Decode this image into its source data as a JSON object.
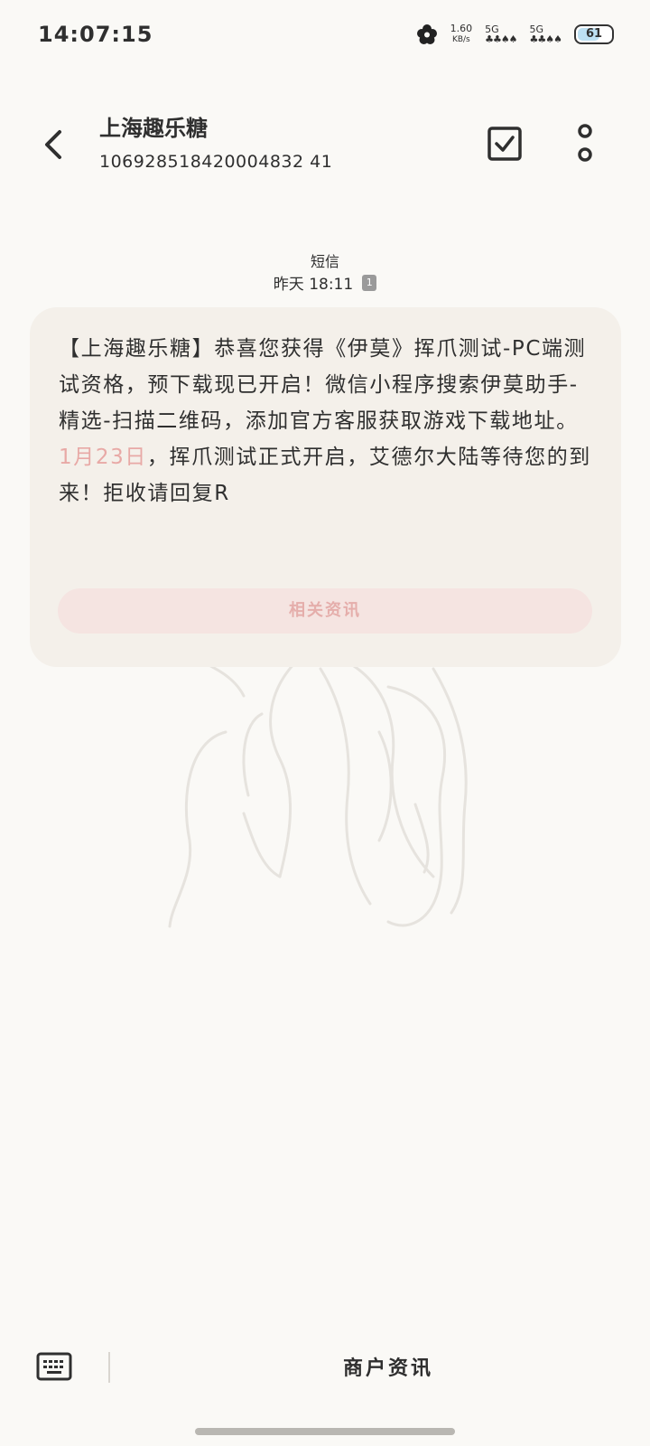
{
  "status_bar": {
    "time": "14:07:15",
    "net_speed_value": "1.60",
    "net_speed_unit": "KB/s",
    "sim1_label": "5G",
    "sim2_label": "5G",
    "battery_level": "61"
  },
  "header": {
    "title": "上海趣乐糖",
    "subtitle": "106928518420004832 41"
  },
  "meta": {
    "label": "短信",
    "time": "昨天 18:11",
    "sim_badge": "1"
  },
  "message": {
    "part1": "【上海趣乐糖】恭喜您获得《伊莫》挥爪测试-PC端测试资格，预下载现已开启！微信小程序搜索伊莫助手-精选-扫描二维码，添加官方客服获取游戏下载地址。",
    "highlight": "1月23日",
    "part2": "，挥爪测试正式开启，艾德尔大陆等待您的到来！拒收请回复R",
    "highlight_color": "#e8a9a6"
  },
  "related_button": {
    "label": "相关资讯"
  },
  "bottom_bar": {
    "label": "商户资讯"
  },
  "icons": {
    "back": "back-arrow-icon",
    "check": "checkbox-icon",
    "more": "more-icon",
    "keyboard": "keyboard-icon"
  }
}
